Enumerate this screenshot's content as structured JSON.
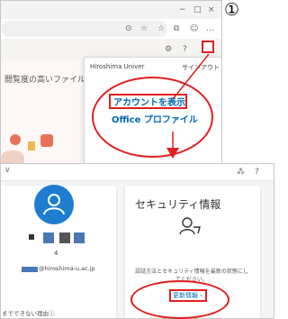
{
  "step_label": "①",
  "browser": {
    "toolbar_icons": [
      "⊙",
      "☆",
      "☆",
      "⧉",
      "☺",
      "…"
    ],
    "settings_icons": [
      "⚙",
      "?"
    ],
    "window_controls": [
      "−",
      "□",
      "×"
    ],
    "page_text": "閲覧度の高いファイル",
    "popup": {
      "org": "Hiroshima Univer",
      "signout": "サインアウト",
      "view_account": "アカウントを表示",
      "office_profile": "Office プロファイル"
    }
  },
  "account": {
    "header_icons": [
      "⁂",
      "?"
    ],
    "user_count": "4",
    "email_suffix": "@hiroshima-u.ac.jp",
    "footer_text": "までできない理由ⓘ",
    "security": {
      "title": "セキュリティ情報",
      "desc": "認証方法とセキュリティ情報を最新の状態にしてください。",
      "update_link": "更新情報 ›"
    }
  },
  "colors": {
    "accent_red": "#e02020",
    "link_blue": "#0067b8",
    "avatar_blue": "#1f7dd0"
  }
}
